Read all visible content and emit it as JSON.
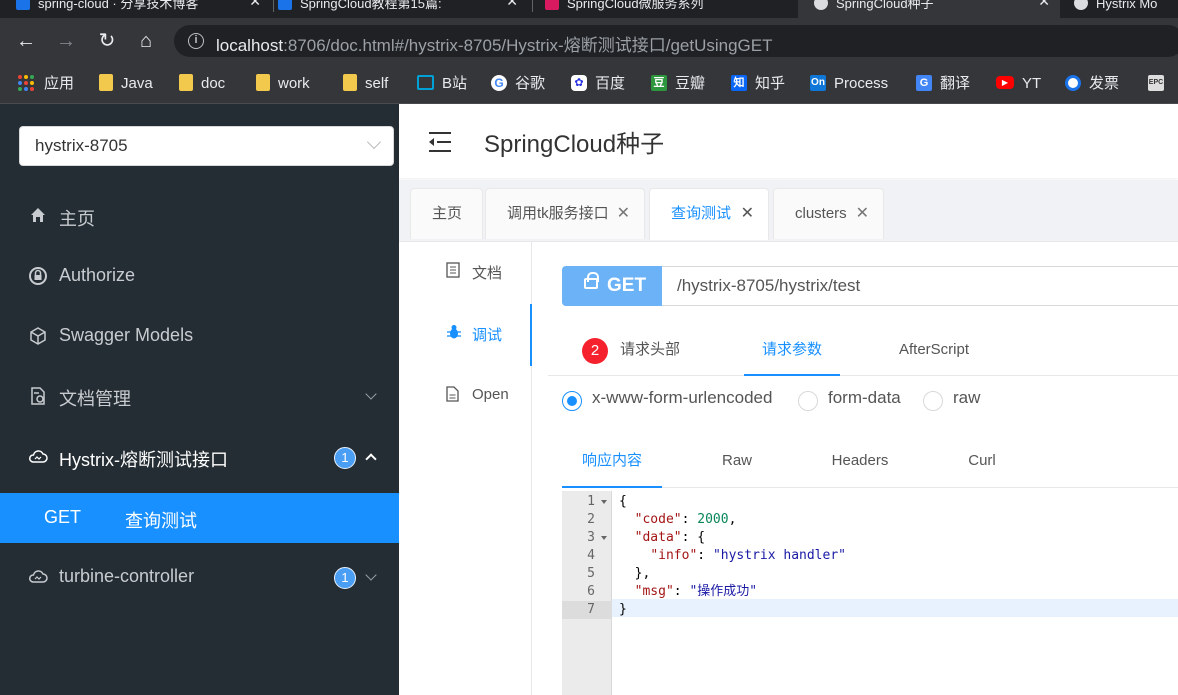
{
  "browser": {
    "tabs": [
      {
        "label": "spring-cloud · 分享技术博客",
        "fav_color": "#1a73e8",
        "close": "✕"
      },
      {
        "label": "SpringCloud教程第15篇:",
        "fav_color": "#1a73e8",
        "close": "✕"
      },
      {
        "label": "SpringCloud微服务系列",
        "fav_color": "#d81b60",
        "close": "✕"
      },
      {
        "label": "SpringCloud种子",
        "fav_color": "#dadce0",
        "close": "✕"
      },
      {
        "label": "Hystrix Mo",
        "fav_color": "#dadce0",
        "close": ""
      }
    ],
    "url_host": "localhost",
    "url_rest": ":8706/doc.html#/hystrix-8705/Hystrix-熔断测试接口/getUsingGET",
    "bookmarks": [
      {
        "label": "应用",
        "kind": "apps-grid",
        "color": ""
      },
      {
        "label": "Java",
        "kind": "folder",
        "color": "#f2c94c"
      },
      {
        "label": "doc",
        "kind": "folder",
        "color": "#f2c94c"
      },
      {
        "label": "work",
        "kind": "folder",
        "color": "#f2c94c"
      },
      {
        "label": "self",
        "kind": "folder",
        "color": "#f2c94c"
      },
      {
        "label": "B站",
        "kind": "bilibili-icon",
        "color": "#00a1d6"
      },
      {
        "label": "谷歌",
        "kind": "google-icon",
        "color": "#ffffff"
      },
      {
        "label": "百度",
        "kind": "baidu-icon",
        "color": "#2932e1"
      },
      {
        "label": "豆瓣",
        "kind": "douban-icon",
        "color": "#2e963d"
      },
      {
        "label": "知乎",
        "kind": "zhihu-icon",
        "color": "#0a66f5"
      },
      {
        "label": "Process",
        "kind": "processon-icon",
        "color": "#0f77d8"
      },
      {
        "label": "翻译",
        "kind": "translate-icon",
        "color": "#4285f4"
      },
      {
        "label": "YT",
        "kind": "youtube-icon",
        "color": "#ff0000"
      },
      {
        "label": "发票",
        "kind": "invoice-icon",
        "color": "#1a73e8"
      }
    ]
  },
  "sidebar": {
    "service_select": "hystrix-8705",
    "items": [
      {
        "label": "主页",
        "icon": "home-icon",
        "chevron": "",
        "badge": ""
      },
      {
        "label": "Authorize",
        "icon": "lock-icon",
        "chevron": "",
        "badge": ""
      },
      {
        "label": "Swagger Models",
        "icon": "cube-icon",
        "chevron": "",
        "badge": ""
      },
      {
        "label": "文档管理",
        "icon": "doc-gear-icon",
        "chevron": "down",
        "badge": ""
      },
      {
        "label": "Hystrix-熔断测试接口",
        "icon": "cloud-icon",
        "chevron": "up",
        "badge": "1"
      },
      {
        "label": "turbine-controller",
        "icon": "cloud-icon",
        "chevron": "down",
        "badge": "1"
      }
    ],
    "active_sub": {
      "method": "GET",
      "label": "查询测试"
    }
  },
  "header": {
    "title": "SpringCloud种子"
  },
  "page_tabs": [
    {
      "label": "主页",
      "closable": false
    },
    {
      "label": "调用tk服务接口",
      "closable": true
    },
    {
      "label": "查询测试",
      "closable": true
    },
    {
      "label": "clusters",
      "closable": true
    }
  ],
  "doc_nav": [
    {
      "label": "文档",
      "icon": "document-icon"
    },
    {
      "label": "调试",
      "icon": "bug-icon"
    },
    {
      "label": "Open",
      "icon": "file-icon"
    }
  ],
  "request": {
    "method": "GET",
    "path": "/hystrix-8705/hystrix/test"
  },
  "request_tabs": {
    "headers": "请求头部",
    "headers_badge": "2",
    "params": "请求参数",
    "afterscript": "AfterScript"
  },
  "body_types": [
    "x-www-form-urlencoded",
    "form-data",
    "raw"
  ],
  "response_tabs": [
    "响应内容",
    "Raw",
    "Headers",
    "Curl"
  ],
  "response_lines": [
    "{",
    "  \"code\": 2000,",
    "  \"data\": {",
    "    \"info\": \"hystrix handler\"",
    "  },",
    "  \"msg\": \"操作成功\"",
    "}"
  ],
  "colors": {
    "accent": "#1890ff",
    "sidebar_bg": "#242d33",
    "method_bg": "#6cb2f7",
    "badge_red": "#f5222d"
  }
}
